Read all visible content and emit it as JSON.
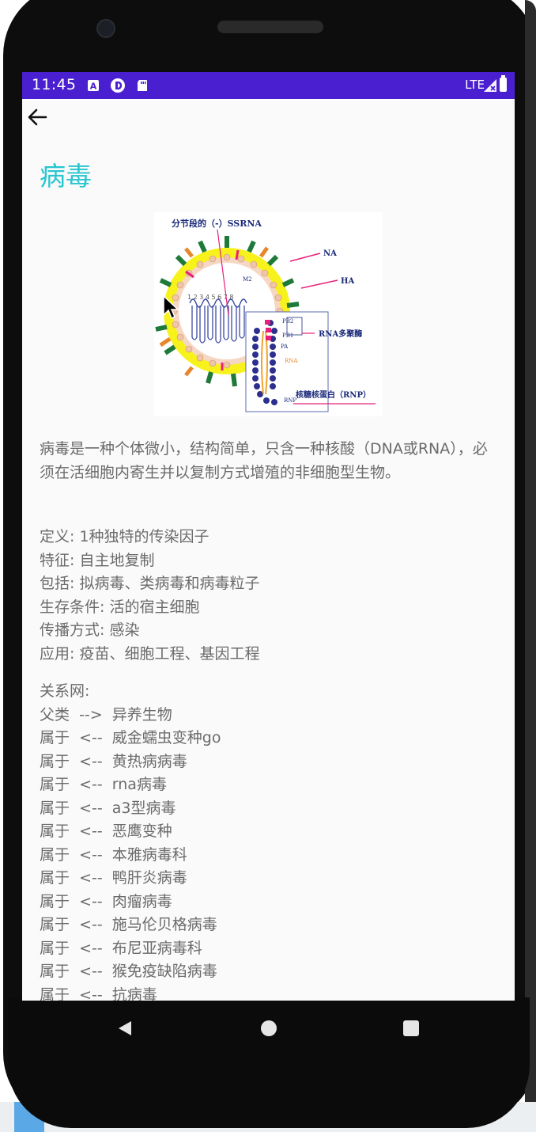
{
  "status_bar": {
    "time": "11:45",
    "network": "LTE",
    "icons": [
      "a-notification-icon",
      "data-saver-icon",
      "sd-card-icon",
      "signal-icon",
      "battery-icon"
    ]
  },
  "header": {
    "back_icon": "arrow-back-icon"
  },
  "page": {
    "title": "病毒",
    "diagram": {
      "labels": {
        "segmented_rna": "分节段的（-）SSRNA",
        "na": "NA",
        "ha": "HA",
        "m2": "M2",
        "pb2": "PB2",
        "pb1": "PB1",
        "pa": "PA",
        "rna": "RNA",
        "rnp": "RNP",
        "rna_polymerase": "RNA多聚酶",
        "nucleocapsid": "核糖核蛋白（RNP）",
        "segment_numbers": "1 2 3 4 5 6 7 8"
      }
    },
    "description": "病毒是一种个体微小，结构简单，只含一种核酸（DNA或RNA），必须在活细胞内寄生并以复制方式增殖的非细胞型生物。",
    "attributes": [
      "定义: 1种独特的传染因子",
      "特征: 自主地复制",
      "包括: 拟病毒、类病毒和病毒粒子",
      "生存条件: 活的宿主细胞",
      "传播方式: 感染",
      "应用: 疫苗、细胞工程、基因工程"
    ],
    "relations_title": "关系网:",
    "relations": [
      "父类  -->  异养生物",
      "属于  <--  威金蠕虫变种go",
      "属于  <--  黄热病病毒",
      "属于  <--  rna病毒",
      "属于  <--  a3型病毒",
      "属于  <--  恶鹰变种",
      "属于  <--  本雅病毒科",
      "属于  <--  鸭肝炎病毒",
      "属于  <--  肉瘤病毒",
      "属于  <--  施马伦贝格病毒",
      "属于  <--  布尼亚病毒科",
      "属于  <--  猴免疫缺陷病毒",
      "属于  <--  抗病毒"
    ]
  },
  "nav_bar": {
    "icons": [
      "nav-back-icon",
      "nav-home-icon",
      "nav-recents-icon"
    ]
  },
  "colors": {
    "status_bar": "#4a1fcf",
    "title": "#26c6cf",
    "body_text": "#6b6b6b",
    "background": "#fafafa"
  }
}
